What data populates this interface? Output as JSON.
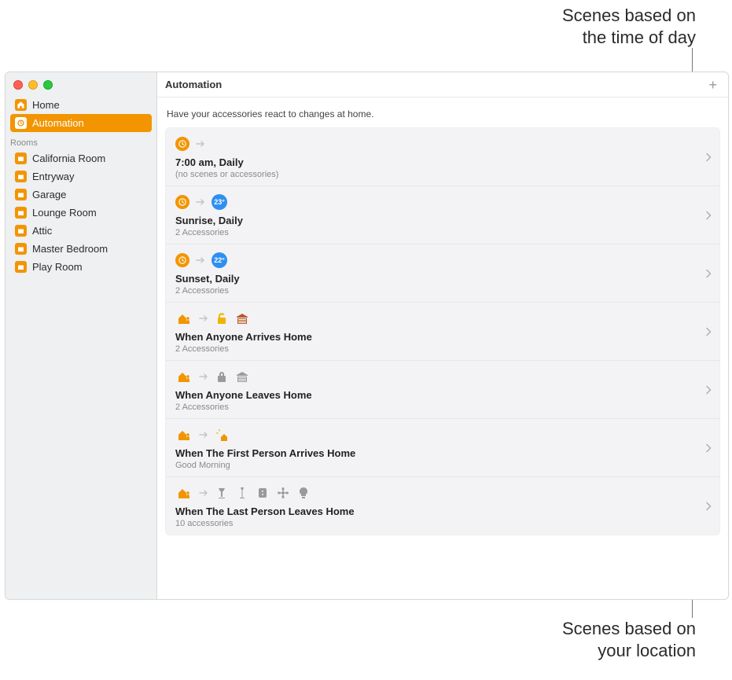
{
  "annotations": {
    "top": "Scenes based on\nthe time of day",
    "bottom": "Scenes based on\nyour location"
  },
  "toolbar": {
    "title": "Automation"
  },
  "subtitle": "Have your accessories react to changes at home.",
  "sidebar": {
    "main": [
      {
        "label": "Home"
      },
      {
        "label": "Automation"
      }
    ],
    "rooms_header": "Rooms",
    "rooms": [
      {
        "label": "California Room"
      },
      {
        "label": "Entryway"
      },
      {
        "label": "Garage"
      },
      {
        "label": "Lounge Room"
      },
      {
        "label": "Attic"
      },
      {
        "label": "Master Bedroom"
      },
      {
        "label": "Play Room"
      }
    ]
  },
  "automations": [
    {
      "title": "7:00 am, Daily",
      "sub": "(no scenes or accessories)",
      "badge": ""
    },
    {
      "title": "Sunrise, Daily",
      "sub": "2 Accessories",
      "badge": "23°"
    },
    {
      "title": "Sunset, Daily",
      "sub": "2 Accessories",
      "badge": "22°"
    },
    {
      "title": "When Anyone Arrives Home",
      "sub": "2 Accessories"
    },
    {
      "title": "When Anyone Leaves Home",
      "sub": "2 Accessories"
    },
    {
      "title": "When The First Person Arrives Home",
      "sub": "Good Morning"
    },
    {
      "title": "When The Last Person Leaves Home",
      "sub": "10 accessories"
    }
  ]
}
